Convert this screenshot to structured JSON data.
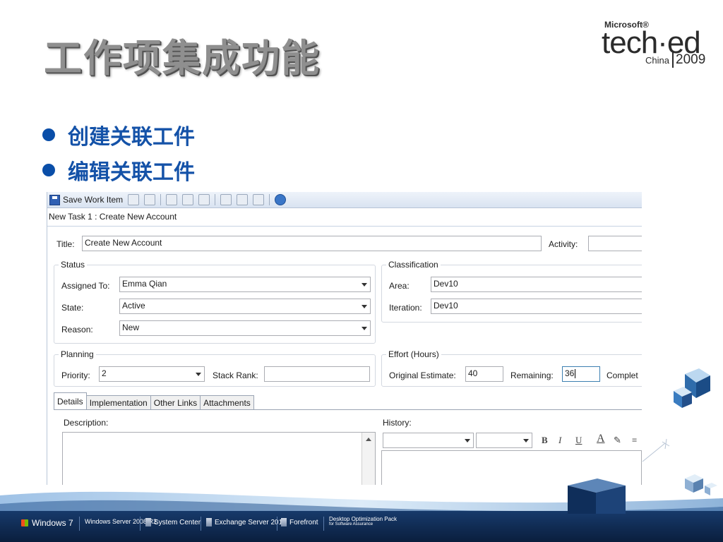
{
  "slide": {
    "title": "工作项集成功能",
    "bullets": [
      "创建关联工件",
      "编辑关联工件"
    ]
  },
  "logo": {
    "microsoft": "Microsoft®",
    "brand": "tech·ed",
    "region": "China",
    "year": "2009"
  },
  "toolbar": {
    "save_label": "Save Work Item"
  },
  "work_item": {
    "header": "New Task 1 : Create New Account",
    "title_label": "Title:",
    "title_value": "Create New Account",
    "activity_label": "Activity:",
    "activity_value": ""
  },
  "status": {
    "legend": "Status",
    "assigned_label": "Assigned To:",
    "assigned_value": "Emma Qian",
    "state_label": "State:",
    "state_value": "Active",
    "reason_label": "Reason:",
    "reason_value": "New"
  },
  "classification": {
    "legend": "Classification",
    "area_label": "Area:",
    "area_value": "Dev10",
    "iteration_label": "Iteration:",
    "iteration_value": "Dev10"
  },
  "planning": {
    "legend": "Planning",
    "priority_label": "Priority:",
    "priority_value": "2",
    "stack_rank_label": "Stack Rank:",
    "stack_rank_value": ""
  },
  "effort": {
    "legend": "Effort (Hours)",
    "original_label": "Original Estimate:",
    "original_value": "40",
    "remaining_label": "Remaining:",
    "remaining_value": "36",
    "completed_label": "Complet"
  },
  "tabs": [
    "Details",
    "Implementation",
    "Other Links",
    "Attachments"
  ],
  "details": {
    "description_label": "Description:",
    "history_label": "History:"
  },
  "footer": {
    "items": [
      "Windows 7",
      "Windows Server 2008 R2",
      "System Center",
      "Exchange Server 2010",
      "Forefront",
      "Desktop Optimization Pack"
    ],
    "sub": "for Software Assurance"
  },
  "colors": {
    "bullet": "#1452a8",
    "title": "#8f8f8f",
    "footer": "#0a1e3d"
  }
}
